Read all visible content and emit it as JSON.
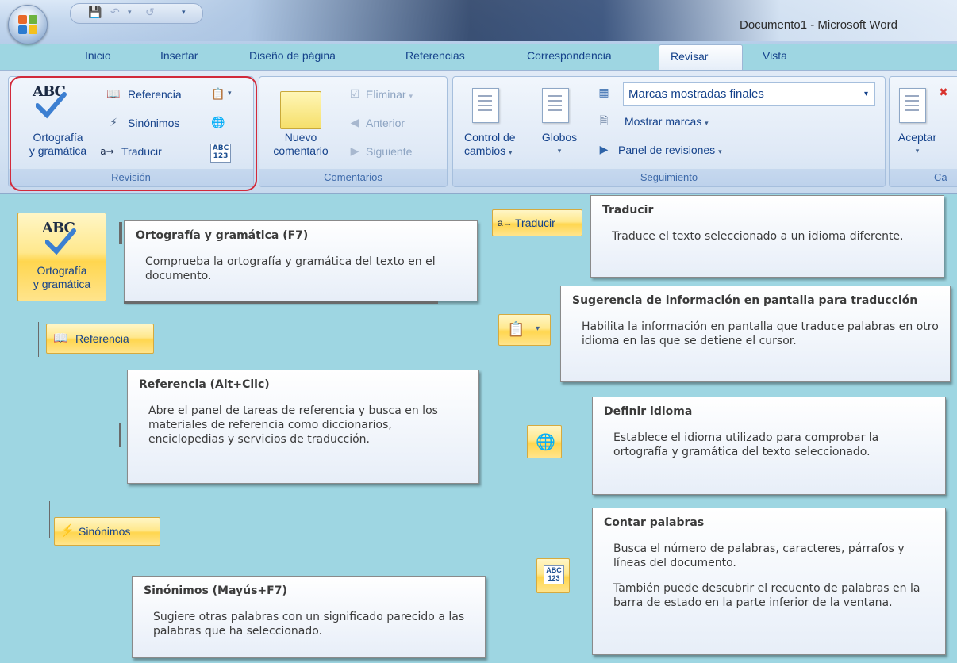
{
  "window": {
    "title": "Documento1 - Microsoft Word"
  },
  "tabs": [
    "Inicio",
    "Insertar",
    "Diseño de página",
    "Referencias",
    "Correspondencia",
    "Revisar",
    "Vista"
  ],
  "active_tab": "Revisar",
  "ribbon": {
    "revision": {
      "label": "Revisión",
      "spelling_line1": "Ortografía",
      "spelling_line2": "y gramática",
      "referencia": "Referencia",
      "sinonimos": "Sinónimos",
      "traducir": "Traducir"
    },
    "comentarios": {
      "label": "Comentarios",
      "nuevo_line1": "Nuevo",
      "nuevo_line2": "comentario",
      "eliminar": "Eliminar",
      "anterior": "Anterior",
      "siguiente": "Siguiente"
    },
    "seguimiento": {
      "label": "Seguimiento",
      "control_line1": "Control de",
      "control_line2": "cambios",
      "globos": "Globos",
      "marcas_select": "Marcas mostradas finales",
      "mostrar_marcas": "Mostrar marcas",
      "panel_revisiones": "Panel de revisiones"
    },
    "cambios": {
      "aceptar": "Aceptar",
      "label_partial": "Ca"
    }
  },
  "buttons": {
    "spelling_line1": "Ortografía",
    "spelling_line2": "y gramática",
    "traducir": "Traducir",
    "referencia": "Referencia",
    "sinonimos": "Sinónimos"
  },
  "tooltips": {
    "ortografia": {
      "title": "Ortografía y gramática (F7)",
      "desc": "Comprueba la ortografía y gramática del texto en el documento."
    },
    "traducir": {
      "title": "Traducir",
      "desc": "Traduce el texto seleccionado a un idioma diferente."
    },
    "sugerencia": {
      "title": "Sugerencia de información en pantalla para traducción",
      "desc": "Habilita la información en pantalla que traduce palabras en otro idioma en las que se detiene el cursor."
    },
    "referencia": {
      "title": "Referencia (Alt+Clic)",
      "desc": "Abre el panel de tareas de referencia y busca en los materiales de referencia como diccionarios, enciclopedias y servicios de traducción."
    },
    "definir_idioma": {
      "title": "Definir idioma",
      "desc": "Establece el idioma utilizado para comprobar la ortografía y gramática del texto seleccionado."
    },
    "contar_palabras": {
      "title": "Contar palabras",
      "desc": "Busca el número de palabras, caracteres, párrafos y líneas del documento.",
      "desc2": "También puede descubrir el recuento de palabras en la barra de estado en la parte inferior de la ventana."
    },
    "sinonimos": {
      "title": "Sinónimos (Mayús+F7)",
      "desc": "Sugiere otras palabras con un significado parecido a las palabras que ha seleccionado."
    }
  },
  "icons": {
    "abc_text": "ABC",
    "abc123_top": "ABC",
    "abc123_bottom": "123"
  },
  "colors": {
    "background": "#9ed6e2",
    "highlight_border": "#d22a3a",
    "ribbon_text": "#15428b"
  }
}
